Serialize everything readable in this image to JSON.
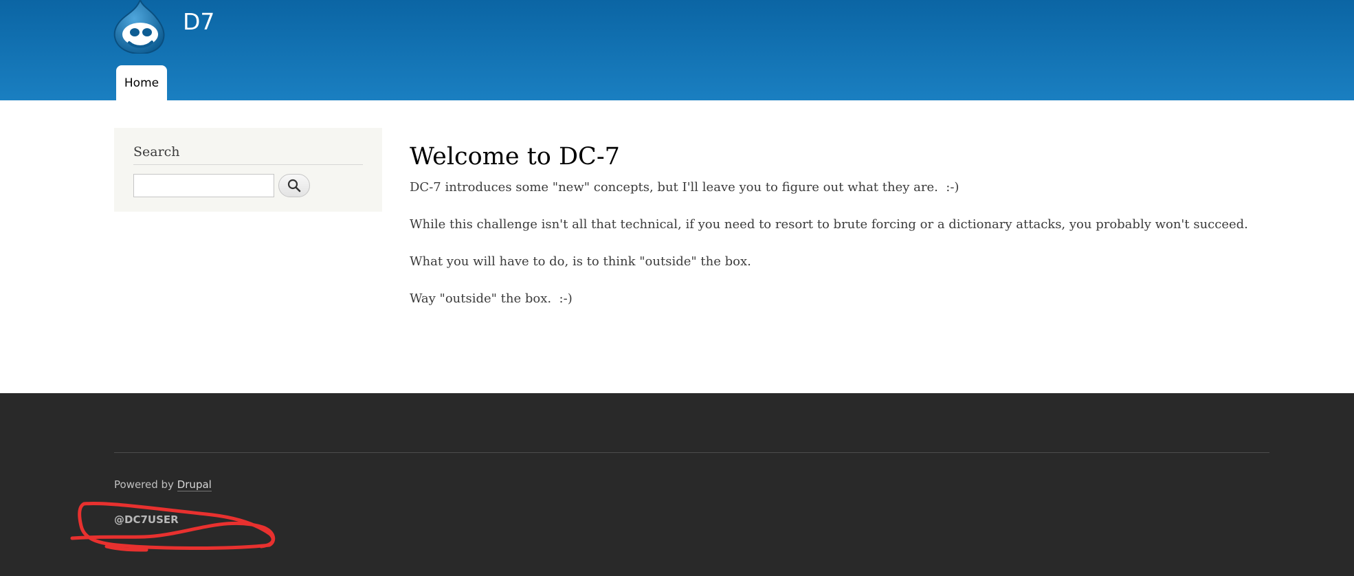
{
  "header": {
    "site_name": "D7",
    "logo_icon": "drupal-drop-icon",
    "menu": [
      {
        "label": "Home",
        "active": true
      }
    ]
  },
  "sidebar": {
    "search_title": "Search",
    "search_value": "",
    "search_button_icon": "search-icon"
  },
  "content": {
    "title": "Welcome to DC-7",
    "paragraphs": [
      "DC-7 introduces some \"new\" concepts, but I'll leave you to figure out what they are.  :-)",
      "While this challenge isn't all that technical, if you need to resort to brute forcing or a dictionary attacks, you probably won't succeed.",
      "What you will have to do, is to think \"outside\" the box.",
      "Way \"outside\" the box.  :-)"
    ]
  },
  "footer": {
    "powered_prefix": "Powered by ",
    "powered_link": "Drupal",
    "handle": "@DC7USER",
    "annotation_color": "#e8312f"
  },
  "colors": {
    "header_top": "#0b65a4",
    "header_bottom": "#1a7fc1",
    "footer_bg": "#292929",
    "sidebar_bg": "#f6f6f2"
  }
}
